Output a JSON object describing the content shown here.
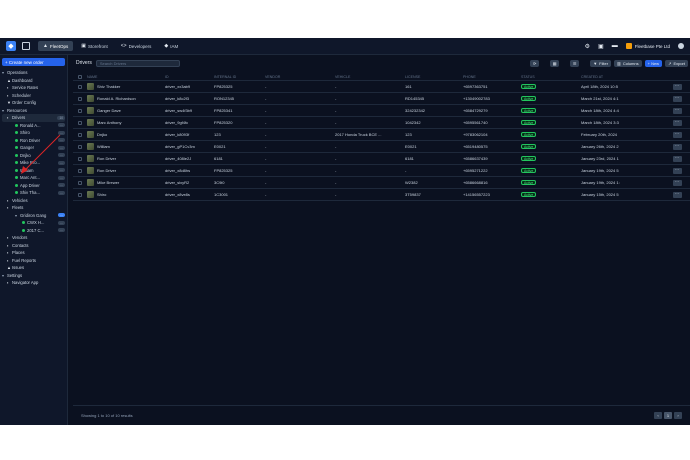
{
  "topbar": {
    "nav": [
      {
        "label": "FleetOps",
        "icon": "chart-icon",
        "active": true
      },
      {
        "label": "Storefront",
        "icon": "store-icon"
      },
      {
        "label": "Developers",
        "icon": "code-icon"
      },
      {
        "label": "IAM",
        "icon": "shield-icon"
      }
    ],
    "org_name": "Fleetbase Pte Ltd"
  },
  "sidebar": {
    "create_label": "+ Create new order",
    "items": [
      {
        "label": "Operations",
        "level": 0,
        "caret": "▾"
      },
      {
        "label": "Dashboard",
        "level": 1,
        "icon": "▲"
      },
      {
        "label": "Service Rates",
        "level": 1,
        "icon": "▪"
      },
      {
        "label": "Scheduler",
        "level": 1,
        "icon": "▪"
      },
      {
        "label": "Order Config",
        "level": 1,
        "icon": "▼"
      },
      {
        "label": "Resources",
        "level": 0,
        "caret": "▾"
      },
      {
        "label": "Drivers",
        "level": 1,
        "icon": "▪",
        "pill": "10",
        "active": true
      },
      {
        "label": "Ronald A...",
        "level": 2,
        "dot": true,
        "pill": "..."
      },
      {
        "label": "Shiro",
        "level": 2,
        "dot": true,
        "pill": "..."
      },
      {
        "label": "Ron Driver",
        "level": 2,
        "dot": true,
        "pill": "..."
      },
      {
        "label": "Ganger",
        "level": 2,
        "dot": true,
        "pill": "..."
      },
      {
        "label": "Dnjko",
        "level": 2,
        "dot": true,
        "pill": "..."
      },
      {
        "label": "Mike Bro...",
        "level": 2,
        "dot": true,
        "pill": "..."
      },
      {
        "label": "William",
        "level": 2,
        "dot": true,
        "pill": "..."
      },
      {
        "label": "Marc Ant...",
        "level": 2,
        "dot": true,
        "pill": "..."
      },
      {
        "label": "App Driver",
        "level": 2,
        "dot": true,
        "pill": "..."
      },
      {
        "label": "Shiv Tha...",
        "level": 2,
        "dot": true,
        "pill": "..."
      },
      {
        "label": "Vehicles",
        "level": 1,
        "icon": "▪"
      },
      {
        "label": "Fleets",
        "level": 1,
        "icon": "▪"
      },
      {
        "label": "Gridiron Gang",
        "level": 2,
        "caret": "▾",
        "pill": "...",
        "pill_blue": true
      },
      {
        "label": "CWX H...",
        "level": 3,
        "dot": true,
        "pill": "..."
      },
      {
        "label": "2017 C...",
        "level": 3,
        "dot": true,
        "pill": "..."
      },
      {
        "label": "Vendors",
        "level": 1,
        "icon": "▪"
      },
      {
        "label": "Contacts",
        "level": 1,
        "icon": "▪"
      },
      {
        "label": "Places",
        "level": 1,
        "icon": "▪"
      },
      {
        "label": "Fuel Reports",
        "level": 1,
        "icon": "▪"
      },
      {
        "label": "Issues",
        "level": 1,
        "icon": "▲"
      },
      {
        "label": "Settings",
        "level": 0,
        "caret": "▾"
      },
      {
        "label": "Navigator App",
        "level": 1,
        "icon": "▪"
      }
    ]
  },
  "toolbar": {
    "title": "Drivers",
    "search_placeholder": "Search Drivers",
    "filter_label": "Filter",
    "columns_label": "Columns",
    "new_label": "+ New",
    "export_label": "Export"
  },
  "table": {
    "headers": [
      "NAME",
      "ID",
      "INTERNAL ID",
      "VENDOR",
      "VEHICLE",
      "LICENSE",
      "PHONE",
      "STATUS",
      "CREATED AT"
    ],
    "rows": [
      {
        "name": "Shiv Thakker",
        "id": "driver_xx3ab9",
        "internal": "FP825325",
        "vendor": "-",
        "vehicle": "-",
        "license": "161",
        "phone": "+6597363751",
        "status": "Active",
        "created": "April 18th, 2024 10:5"
      },
      {
        "name": "Ronald A. Richardson",
        "id": "driver_k8c2f3",
        "internal": "RON12345",
        "vendor": "-",
        "vehicle": "-",
        "license": "RD145345",
        "phone": "+13049002783",
        "status": "Active",
        "created": "March 21st, 2024 4:1"
      },
      {
        "name": "Ganger Dave",
        "id": "driver_sw4f3b9",
        "internal": "FP825341",
        "vendor": "-",
        "vehicle": "-",
        "license": "324232342",
        "phone": "+6584729279",
        "status": "Active",
        "created": "March 18th, 2024 4:4"
      },
      {
        "name": "Marc Anthony",
        "id": "driver_9gf4fc",
        "internal": "FP825320",
        "vendor": "-",
        "vehicle": "-",
        "license": "1042342",
        "phone": "+6595561740",
        "status": "Active",
        "created": "March 18th, 2024 3:3"
      },
      {
        "name": "Dnjko",
        "id": "driver_k8093f",
        "internal": "123",
        "vendor": "-",
        "vehicle": "2017 Honda Truck BCE ...",
        "license": "123",
        "phone": "+9783062104",
        "status": "Active",
        "created": "February 20th, 2024"
      },
      {
        "name": "William",
        "id": "driver_gP1Cv3m",
        "internal": "E0021",
        "vendor": "-",
        "vehicle": "-",
        "license": "E0021",
        "phone": "+6519480575",
        "status": "Active",
        "created": "January 26th, 2024 2"
      },
      {
        "name": "Ron Driver",
        "id": "driver_408le2J",
        "internal": "6181",
        "vendor": "-",
        "vehicle": "-",
        "license": "6181",
        "phone": "+6586637439",
        "status": "Active",
        "created": "January 23rd, 2024 1"
      },
      {
        "name": "Ron Driver",
        "id": "driver_x8d8hs",
        "internal": "FP825325",
        "vendor": "-",
        "vehicle": "-",
        "license": "-",
        "phone": "+6595271222",
        "status": "Active",
        "created": "January 19th, 2024 5"
      },
      {
        "name": "Mike Brewer",
        "id": "driver_slxyR2",
        "internal": "3C9i0",
        "vendor": "-",
        "vehicle": "-",
        "license": "W2382",
        "phone": "+6586668816",
        "status": "Active",
        "created": "January 19th, 2024 1:"
      },
      {
        "name": "Shiro",
        "id": "driver_x8ve8s",
        "internal": "1C3001",
        "vendor": "-",
        "vehicle": "-",
        "license": "3T59837",
        "phone": "+14156557223",
        "status": "Active",
        "created": "January 15th, 2024 5"
      }
    ]
  },
  "footer": {
    "showing": "Showing 1 to 10 of 10 results",
    "page": "1"
  },
  "colors": {
    "accent": "#2563eb",
    "active": "#22c55e",
    "background": "#0b1120",
    "annotation": "#dc2626"
  }
}
